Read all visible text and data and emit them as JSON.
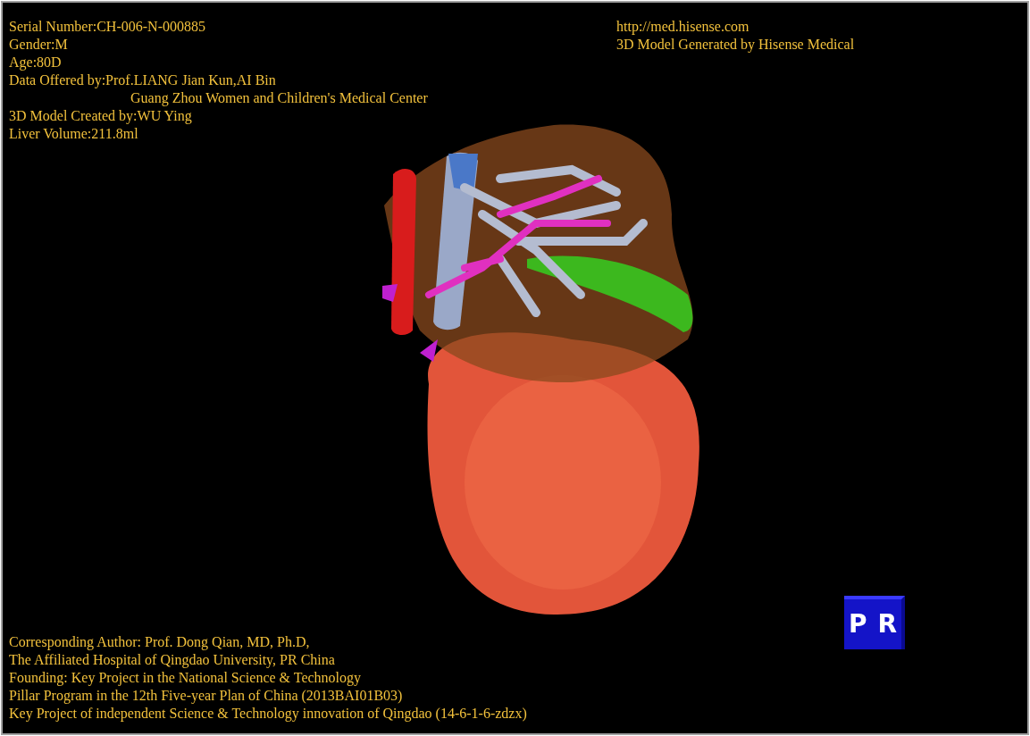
{
  "header_left": [
    {
      "kind": "line",
      "text": "Serial Number:CH-006-N-000885"
    },
    {
      "kind": "line",
      "text": "Gender:M"
    },
    {
      "kind": "line",
      "text": "Age:80D"
    },
    {
      "kind": "line",
      "text": "Data Offered by:Prof.LIANG Jian Kun,AI Bin"
    },
    {
      "kind": "continuation",
      "text": "Guang Zhou Women and Children's Medical Center"
    },
    {
      "kind": "line",
      "text": "3D Model Created by:WU Ying"
    },
    {
      "kind": "line",
      "text": "Liver Volume:211.8ml"
    }
  ],
  "header_right": [
    "http://med.hisense.com",
    "3D Model Generated by Hisense Medical"
  ],
  "orientation_cube": {
    "labels": [
      "P",
      "R"
    ]
  },
  "footer": [
    "Corresponding Author: Prof. Dong Qian, MD, Ph.D,",
    "The Affiliated Hospital of Qingdao University, PR China",
    "Founding: Key Project in the National Science & Technology",
    "Pillar Program in the 12th Five-year Plan of China (2013BAI01B03)",
    "Key Project of independent Science & Technology innovation of Qingdao (14-6-1-6-zdzx)"
  ]
}
